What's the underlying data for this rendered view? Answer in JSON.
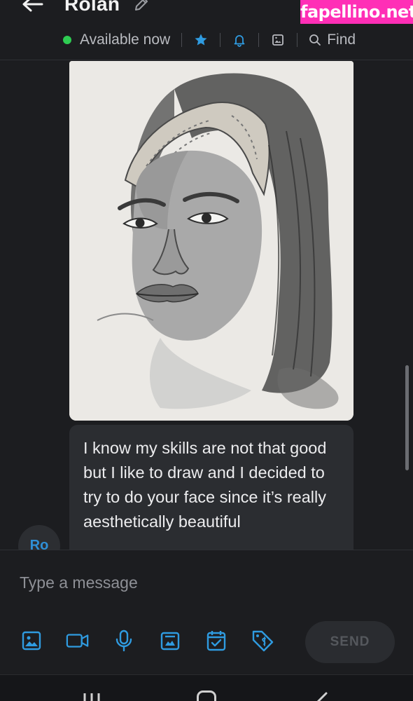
{
  "header": {
    "contact_name": "Rolan",
    "status": "Available now",
    "find_label": "Find",
    "icons": [
      "back-arrow-icon",
      "pencil-icon",
      "star-icon",
      "bell-icon",
      "gallery-icon",
      "search-icon"
    ],
    "watermark": "fapellino.net",
    "status_color": "#2ecc52",
    "accent_color": "#2f9be0"
  },
  "chat": {
    "image_description_icon": "pencil-portrait-drawing",
    "message_text": "I know my skills are not that good but I like to draw and I decided to try to do your face since it’s really aesthetically beautiful",
    "avatar_initials": "Ro",
    "avatar_color": "#2f8fd6"
  },
  "composer": {
    "placeholder": "Type a message",
    "send_label": "SEND",
    "tool_icons": [
      "image-icon",
      "video-icon",
      "microphone-icon",
      "album-icon",
      "calendar-check-icon",
      "price-tag-icon"
    ]
  },
  "system_nav": {
    "icons": [
      "recent-apps-icon",
      "home-icon",
      "back-icon"
    ]
  }
}
